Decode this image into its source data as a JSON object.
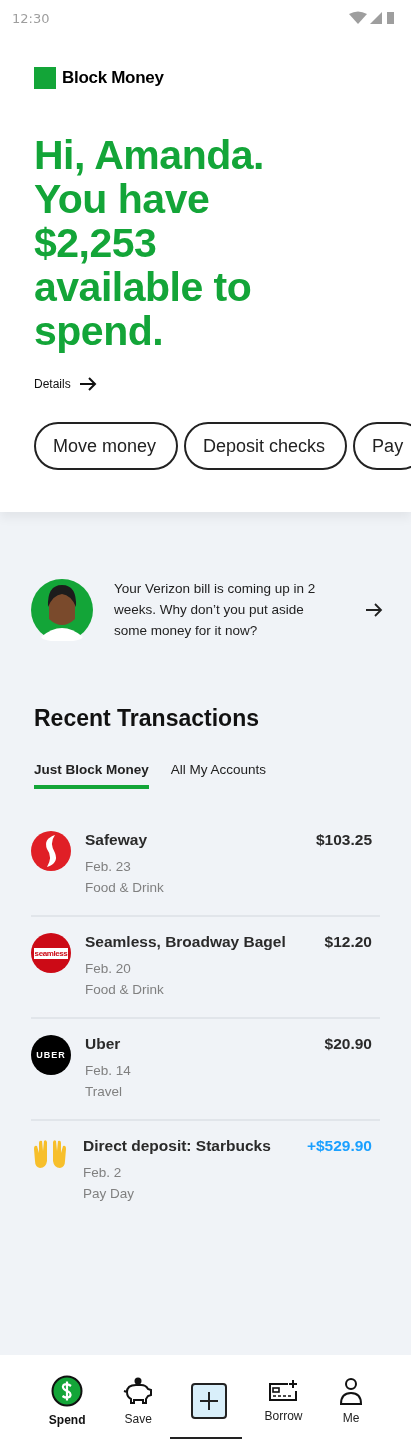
{
  "status_bar": {
    "time": "12:30"
  },
  "brand": {
    "name": "Block Money"
  },
  "greeting": {
    "lines": [
      "Hi, Amanda.",
      "You have",
      "$2,253",
      "available to",
      "spend."
    ]
  },
  "details_link": {
    "label": "Details"
  },
  "actions": [
    {
      "label": "Move money"
    },
    {
      "label": "Deposit checks"
    },
    {
      "label": "Pay"
    }
  ],
  "reminder": {
    "text": "Your Verizon bill is coming up in 2 weeks. Why don’t you put aside some money for it now?"
  },
  "transactions": {
    "title": "Recent Transactions",
    "tabs": [
      {
        "label": "Just Block Money",
        "selected": true
      },
      {
        "label": "All My Accounts",
        "selected": false
      }
    ],
    "rows": [
      {
        "kind": "safeway",
        "merchant": "Safeway",
        "amount": "$103.25",
        "credit": false,
        "date": "Feb. 23",
        "category": "Food & Drink"
      },
      {
        "kind": "seamless",
        "logo_text": "seamless",
        "merchant": "Seamless, Broadway Bagel",
        "amount": "$12.20",
        "credit": false,
        "date": "Feb. 20",
        "category": "Food & Drink"
      },
      {
        "kind": "uber",
        "logo_text": "UBER",
        "merchant": "Uber",
        "amount": "$20.90",
        "credit": false,
        "date": "Feb. 14",
        "category": "Travel"
      },
      {
        "kind": "hands",
        "merchant": "Direct deposit: Starbucks",
        "amount": "+$529.90",
        "credit": true,
        "date": "Feb. 2",
        "category": "Pay Day"
      }
    ]
  },
  "nav": [
    {
      "kind": "dollar",
      "label": "Spend",
      "selected": true
    },
    {
      "kind": "piggy",
      "label": "Save",
      "selected": false
    },
    {
      "kind": "plus",
      "selected": false
    },
    {
      "kind": "card",
      "label": "Borrow",
      "selected": false
    },
    {
      "kind": "person",
      "label": "Me",
      "selected": false
    }
  ]
}
